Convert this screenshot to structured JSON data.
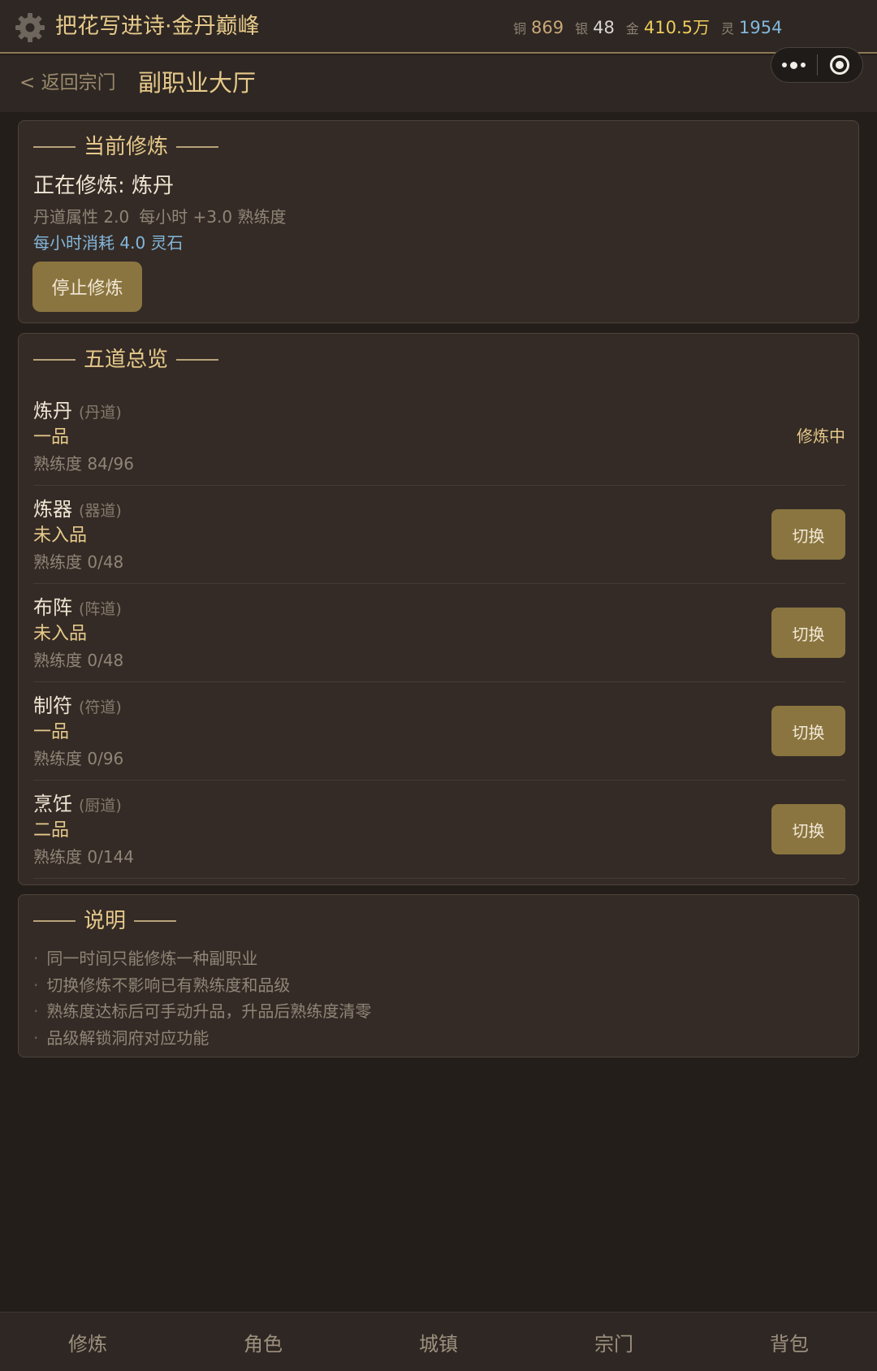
{
  "header": {
    "player_title": "把花写进诗·金丹巅峰",
    "currencies": [
      {
        "label": "铜",
        "value": "869"
      },
      {
        "label": "银",
        "value": "48"
      },
      {
        "label": "金",
        "value": "410.5万"
      },
      {
        "label": "灵",
        "value": "1954"
      }
    ]
  },
  "subheader": {
    "back_label": "< 返回宗门",
    "page_title": "副职业大厅"
  },
  "current": {
    "section_title": "当前修炼",
    "status_line": "正在修炼: 炼丹",
    "attribute": "丹道属性 2.0",
    "rate": "每小时 +3.0 熟练度",
    "cost": "每小时消耗 4.0 灵石",
    "stop_label": "停止修炼"
  },
  "paths": {
    "section_title": "五道总览",
    "switch_label": "切换",
    "active_label": "修炼中",
    "items": [
      {
        "name": "炼丹",
        "category": "(丹道)",
        "rank": "一品",
        "progress": "熟练度 84/96",
        "active": true
      },
      {
        "name": "炼器",
        "category": "(器道)",
        "rank": "未入品",
        "progress": "熟练度 0/48",
        "active": false
      },
      {
        "name": "布阵",
        "category": "(阵道)",
        "rank": "未入品",
        "progress": "熟练度 0/48",
        "active": false
      },
      {
        "name": "制符",
        "category": "(符道)",
        "rank": "一品",
        "progress": "熟练度 0/96",
        "active": false
      },
      {
        "name": "烹饪",
        "category": "(厨道)",
        "rank": "二品",
        "progress": "熟练度 0/144",
        "active": false
      }
    ]
  },
  "notes": {
    "section_title": "说明",
    "bullet": "·",
    "items": [
      "同一时间只能修炼一种副职业",
      "切换修炼不影响已有熟练度和品级",
      "熟练度达标后可手动升品，升品后熟练度清零",
      "品级解锁洞府对应功能"
    ]
  },
  "nav": {
    "items": [
      "修炼",
      "角色",
      "城镇",
      "宗门",
      "背包"
    ]
  },
  "colors": {
    "accent_gold": "#e6c98a",
    "button_bg": "#8a7540",
    "spirit_blue": "#83b7dc",
    "gold_currency": "#f0cc5c"
  },
  "icons": {
    "settings": "gear-icon",
    "more": "more-dots-icon",
    "close_mini": "target-icon"
  }
}
